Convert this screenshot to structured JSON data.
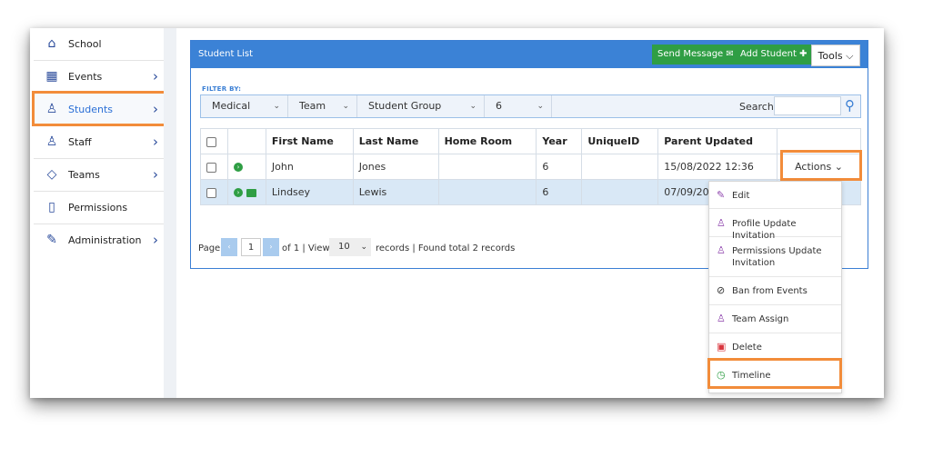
{
  "sidebar": {
    "items": [
      {
        "label": "School",
        "icon": "home-icon",
        "chevron": ""
      },
      {
        "label": "Events",
        "icon": "calendar-icon",
        "chevron": "›"
      },
      {
        "label": "Students",
        "icon": "students-icon",
        "chevron": "›"
      },
      {
        "label": "Staff",
        "icon": "staff-icon",
        "chevron": "›"
      },
      {
        "label": "Teams",
        "icon": "tag-icon",
        "chevron": "›"
      },
      {
        "label": "Permissions",
        "icon": "document-icon",
        "chevron": ""
      },
      {
        "label": "Administration",
        "icon": "pin-icon",
        "chevron": "›"
      }
    ]
  },
  "panel": {
    "title": "Student List",
    "send_message": "Send Message ✉",
    "add_student": "Add Student ✚",
    "tools": "Tools ⌵"
  },
  "filter": {
    "label": "FILTER BY:",
    "selects": [
      "Medical",
      "Team",
      "Student Group",
      "6"
    ],
    "search_label": "Search:",
    "search_value": ""
  },
  "table": {
    "headers": [
      "",
      "",
      "First Name",
      "Last Name",
      "Home Room",
      "Year",
      "UniqueID",
      "Parent Updated",
      ""
    ],
    "rows": [
      {
        "first": "John",
        "last": "Jones",
        "home": "",
        "year": "6",
        "uid": "",
        "updated": "15/08/2022 12:36",
        "actions": "Actions ⌄"
      },
      {
        "first": "Lindsey",
        "last": "Lewis",
        "home": "",
        "year": "6",
        "uid": "",
        "updated": "07/09/2022",
        "actions": ""
      }
    ]
  },
  "pager": {
    "page_label": "Page",
    "page": "1",
    "of": "of 1 | View",
    "view": "10",
    "records": "records | Found total 2 records"
  },
  "menu": {
    "items": [
      {
        "label": "Edit",
        "icon": "pencil-icon",
        "glyph": "✎",
        "color": "#8e44ad"
      },
      {
        "label": "Profile Update Invitation",
        "icon": "user-group-icon",
        "glyph": "♙",
        "color": "#8e44ad"
      },
      {
        "label": "Permissions Update Invitation",
        "icon": "user-icon",
        "glyph": "♙",
        "color": "#8e44ad"
      },
      {
        "label": "Ban from Events",
        "icon": "ban-icon",
        "glyph": "⊘",
        "color": "#333333"
      },
      {
        "label": "Team Assign",
        "icon": "team-icon",
        "glyph": "♙",
        "color": "#8e44ad"
      },
      {
        "label": "Delete",
        "icon": "trash-icon",
        "glyph": "🗑",
        "color": "#d9363e"
      },
      {
        "label": "Timeline",
        "icon": "clock-icon",
        "glyph": "◷",
        "color": "#2f9e44"
      }
    ]
  },
  "colors": {
    "accent": "#3b82d6",
    "green": "#2f9e44",
    "highlight": "#f28c3a"
  }
}
